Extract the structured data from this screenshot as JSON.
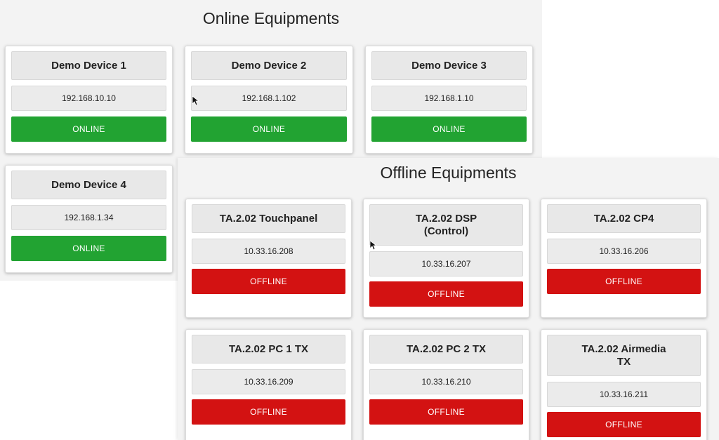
{
  "online": {
    "title": "Online Equipments",
    "devices": [
      {
        "name": "Demo Device 1",
        "ip": "192.168.10.10",
        "status": "ONLINE"
      },
      {
        "name": "Demo Device 2",
        "ip": "192.168.1.102",
        "status": "ONLINE"
      },
      {
        "name": "Demo Device 3",
        "ip": "192.168.1.10",
        "status": "ONLINE"
      },
      {
        "name": "Demo Device 4",
        "ip": "192.168.1.34",
        "status": "ONLINE"
      }
    ]
  },
  "offline": {
    "title": "Offline Equipments",
    "devices": [
      {
        "name": "TA.2.02 Touchpanel",
        "ip": "10.33.16.208",
        "status": "OFFLINE"
      },
      {
        "name": "TA.2.02 DSP (Control)",
        "ip": "10.33.16.207",
        "status": "OFFLINE"
      },
      {
        "name": "TA.2.02 CP4",
        "ip": "10.33.16.206",
        "status": "OFFLINE"
      },
      {
        "name": "TA.2.02 PC 1 TX",
        "ip": "10.33.16.209",
        "status": "OFFLINE"
      },
      {
        "name": "TA.2.02 PC 2 TX",
        "ip": "10.33.16.210",
        "status": "OFFLINE"
      },
      {
        "name": "TA.2.02 Airmedia TX",
        "ip": "10.33.16.211",
        "status": "OFFLINE"
      }
    ]
  },
  "colors": {
    "online": "#22a332",
    "offline": "#d31212"
  },
  "icons": {
    "cursor": "mouse-pointer-icon"
  }
}
